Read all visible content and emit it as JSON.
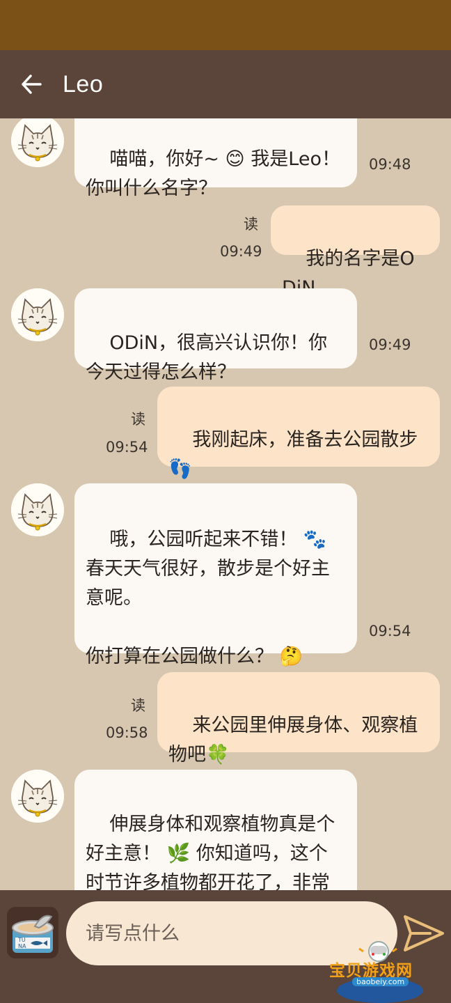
{
  "header": {
    "title": "Leo"
  },
  "messages": [
    {
      "from": "bot",
      "text": "喵喵，你好~ 😊 我是Leo！\n你叫什么名字？",
      "time": "09:48"
    },
    {
      "from": "user",
      "text": "我的名字是ODiN",
      "time": "09:49",
      "read": "读"
    },
    {
      "from": "bot",
      "text": "ODiN，很高兴认识你！你今天过得怎么样？",
      "time": "09:49"
    },
    {
      "from": "user",
      "text": "我刚起床，准备去公园散步\n👣",
      "time": "09:54",
      "read": "读"
    },
    {
      "from": "bot",
      "text": "哦，公园听起来不错！ 🐾 春天天气很好，散步是个好主意呢。\n\n你打算在公园做什么？ 🤔",
      "time": "09:54"
    },
    {
      "from": "user",
      "text": "来公园里伸展身体、观察植物吧🍀",
      "time": "09:58",
      "read": "读"
    },
    {
      "from": "bot",
      "text": "伸展身体和观察植物真是个好主意！ 🌿 你知道吗，这个时节许多植物都开花了，非常漂亮🌸",
      "time": ""
    }
  ],
  "composer": {
    "placeholder": "请写点什么"
  },
  "watermark": {
    "text": "宝贝游戏网",
    "url": "baobeiy.com"
  },
  "colors": {
    "status_bar": "#7b5118",
    "app_bar": "#5b443a",
    "chat_bg": "#d8c7b0",
    "bubble_in": "#fcf9f4",
    "bubble_out": "#fde4c9"
  },
  "icons": [
    "back-arrow-icon",
    "cat-avatar-icon",
    "tuna-can-icon",
    "send-icon"
  ]
}
